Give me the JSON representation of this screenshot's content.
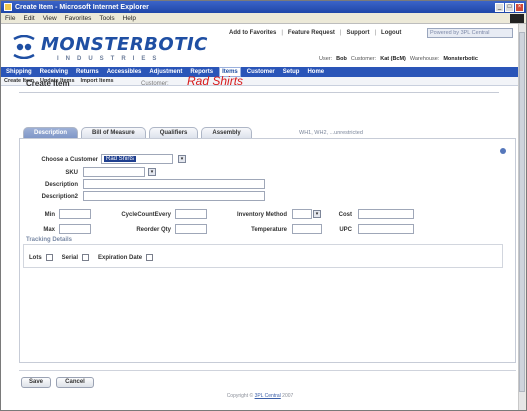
{
  "window": {
    "title": "Create Item - Microsoft Internet Explorer"
  },
  "menubar": [
    "File",
    "Edit",
    "View",
    "Favorites",
    "Tools",
    "Help"
  ],
  "header": {
    "logo_main": "MONSTERBOTIC",
    "logo_sub": "INDUSTRIES",
    "toplinks": [
      "Add to Favorites",
      "Feature Request",
      "Support",
      "Logout"
    ],
    "search_placeholder": "Powered by 3PL Central",
    "user_label": "User:",
    "user_value": "Bob",
    "customer_label": "Customer:",
    "customer_value": "Kat (BcM)",
    "warehouse_label": "Warehouse:",
    "warehouse_value": "Monsterbotic"
  },
  "nav": [
    "Shipping",
    "Receiving",
    "Returns",
    "Accessibles",
    "Adjustment",
    "Reports",
    "Items",
    "Customer",
    "Setup",
    "Home"
  ],
  "nav_active": "Items",
  "subnav": [
    "Create Item",
    "Update Items",
    "Import Items"
  ],
  "page": {
    "title": "Create Item",
    "customer_label": "Customer:",
    "customer_name": "Rad Shirts"
  },
  "tabs": [
    "Description",
    "Bill of Measure",
    "Qualifiers",
    "Assembly"
  ],
  "tab_active": "Description",
  "tab_extra": "WH1, WH2, ...unrestricted",
  "form": {
    "choose_customer_label": "Choose a Customer",
    "choose_customer_value": "Rad Shirts",
    "sku_label": "SKU",
    "description_label": "Description",
    "description2_label": "Description2",
    "min_label": "Min",
    "max_label": "Max",
    "cycle_count_label": "CycleCountEvery",
    "reorder_qty_label": "Reorder Qty",
    "inventory_method_label": "Inventory Method",
    "temperature_label": "Temperature",
    "cost_label": "Cost",
    "upc_label": "UPC"
  },
  "tracking": {
    "title": "Tracking Details",
    "items": [
      "Lots",
      "Serial",
      "Expiration Date"
    ]
  },
  "buttons": {
    "save": "Save",
    "cancel": "Cancel"
  },
  "footer": {
    "prefix": "Copyright ©",
    "link": "3PL Central",
    "suffix": "2007"
  },
  "colors": {
    "nav": "#2a55b8",
    "logo": "#1f4fa3",
    "customer_name": "#d81b1b"
  }
}
